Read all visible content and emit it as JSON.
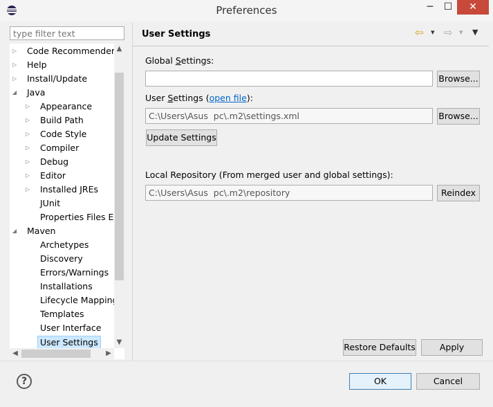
{
  "window": {
    "title": "Preferences",
    "minimize": "─",
    "maximize": "☐",
    "close": "✕"
  },
  "filter": {
    "placeholder": "type filter text"
  },
  "tree": {
    "items": [
      {
        "label": "Code Recommenders",
        "level": 0,
        "expander": "▷"
      },
      {
        "label": "Help",
        "level": 0,
        "expander": "▷"
      },
      {
        "label": "Install/Update",
        "level": 0,
        "expander": "▷"
      },
      {
        "label": "Java",
        "level": 0,
        "expander": "◢"
      },
      {
        "label": "Appearance",
        "level": 1,
        "expander": "▷"
      },
      {
        "label": "Build Path",
        "level": 1,
        "expander": "▷"
      },
      {
        "label": "Code Style",
        "level": 1,
        "expander": "▷"
      },
      {
        "label": "Compiler",
        "level": 1,
        "expander": "▷"
      },
      {
        "label": "Debug",
        "level": 1,
        "expander": "▷"
      },
      {
        "label": "Editor",
        "level": 1,
        "expander": "▷"
      },
      {
        "label": "Installed JREs",
        "level": 1,
        "expander": "▷"
      },
      {
        "label": "JUnit",
        "level": 1,
        "expander": ""
      },
      {
        "label": "Properties Files Ed",
        "level": 1,
        "expander": ""
      },
      {
        "label": "Maven",
        "level": 0,
        "expander": "◢"
      },
      {
        "label": "Archetypes",
        "level": 1,
        "expander": ""
      },
      {
        "label": "Discovery",
        "level": 1,
        "expander": ""
      },
      {
        "label": "Errors/Warnings",
        "level": 1,
        "expander": ""
      },
      {
        "label": "Installations",
        "level": 1,
        "expander": ""
      },
      {
        "label": "Lifecycle Mapping",
        "level": 1,
        "expander": ""
      },
      {
        "label": "Templates",
        "level": 1,
        "expander": ""
      },
      {
        "label": "User Interface",
        "level": 1,
        "expander": ""
      },
      {
        "label": "User Settings",
        "level": 1,
        "expander": "",
        "selected": true
      }
    ]
  },
  "page": {
    "title": "User Settings",
    "global_settings_label": "Global Settings:",
    "global_settings_value": "",
    "user_settings_label_pre": "User Settings (",
    "open_file_link": "open file",
    "user_settings_label_post": "):",
    "user_settings_value": "C:\\Users\\Asus  pc\\.m2\\settings.xml",
    "browse_label": "Browse...",
    "update_settings_label": "Update Settings",
    "local_repo_label": "Local Repository (From merged user and global settings):",
    "local_repo_value": "C:\\Users\\Asus  pc\\.m2\\repository",
    "reindex_label": "Reindex",
    "restore_defaults_label": "Restore Defaults",
    "apply_label": "Apply"
  },
  "footer": {
    "help": "?",
    "ok_label": "OK",
    "cancel_label": "Cancel"
  },
  "icons": {
    "back": "⇦",
    "forward": "⇨",
    "dropdown": "▾",
    "view_menu": "▼"
  }
}
